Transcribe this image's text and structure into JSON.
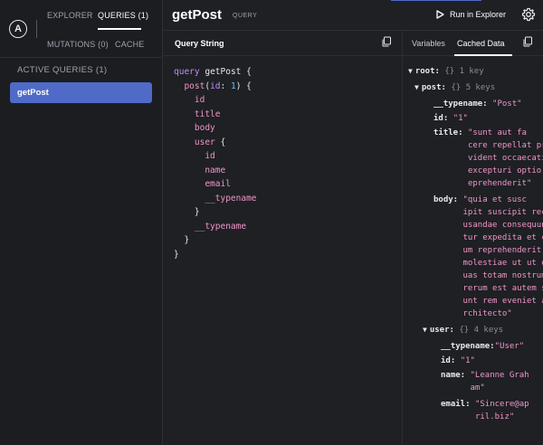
{
  "sidebar": {
    "logo": "A",
    "tabs": {
      "explorer": "EXPLORER",
      "queries": "QUERIES (1)",
      "mutations": "MUTATIONS (0)",
      "cache": "CACHE"
    },
    "active_heading": "ACTIVE QUERIES (1)",
    "queries": [
      {
        "label": "getPost"
      }
    ]
  },
  "header": {
    "title": "getPost",
    "badge": "QUERY",
    "run_label": "Run in Explorer"
  },
  "query_panel": {
    "title": "Query String",
    "code": {
      "l1_kw": "query",
      "l1_name": "getPost",
      "l2_field": "post",
      "l2_arg": "id",
      "l2_val": "1",
      "fields": [
        "id",
        "title",
        "body",
        "user"
      ],
      "user_fields": [
        "id",
        "name",
        "email",
        "__typename"
      ],
      "post_typename": "__typename"
    }
  },
  "data_panel": {
    "tabs": {
      "variables": "Variables",
      "cached": "Cached Data"
    },
    "root": {
      "key": "root:",
      "meta": "{} 1 key"
    },
    "post": {
      "key": "post:",
      "meta": "{} 5 keys"
    },
    "post_fields": {
      "typename_key": "__typename:",
      "typename_val": "\"Post\"",
      "id_key": "id:",
      "id_val": "\"1\"",
      "title_key": "title:",
      "title_val": "\"sunt aut fa\ncere repellat pro\nvident occaecati\nexcepturi optio r\neprehenderit\"",
      "body_key": "body:",
      "body_val": "\"quia et susc\nipit suscipit rec\nusandae consequun\ntur expedita et c\num reprehenderit\nmolestiae ut ut q\nuas totam nostrum\nrerum est autem s\nunt rem eveniet a\nrchitecto\""
    },
    "user": {
      "key": "user:",
      "meta": "{} 4 keys"
    },
    "user_fields": {
      "typename_key": "__typename:",
      "typename_val": "\"User\"",
      "id_key": "id:",
      "id_val": "\"1\"",
      "name_key": "name:",
      "name_val": "\"Leanne Grah\nam\"",
      "email_key": "email:",
      "email_val": "\"Sincere@ap\nril.biz\""
    }
  },
  "colors": {
    "accent": "#4f6bc7",
    "keyword": "#c48ef7",
    "field": "#f295c9",
    "number": "#68c0e8"
  }
}
